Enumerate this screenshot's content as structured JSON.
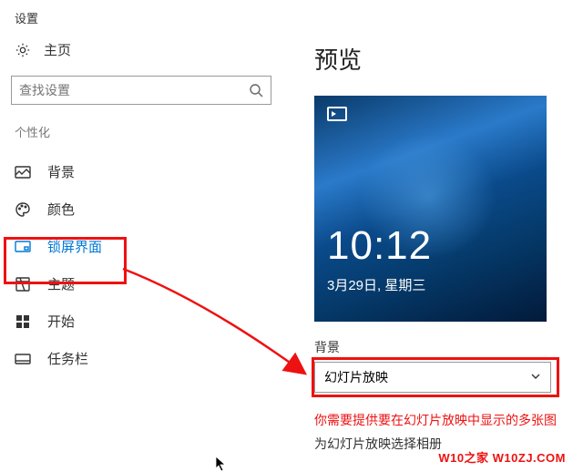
{
  "header": {
    "title": "设置"
  },
  "sidebar": {
    "home_label": "主页",
    "search_placeholder": "查找设置",
    "section_label": "个性化",
    "items": [
      {
        "label": "背景"
      },
      {
        "label": "颜色"
      },
      {
        "label": "锁屏界面"
      },
      {
        "label": "主题"
      },
      {
        "label": "开始"
      },
      {
        "label": "任务栏"
      }
    ]
  },
  "main": {
    "preview_title": "预览",
    "clock": "10:12",
    "date": "3月29日, 星期三",
    "bg_label": "背景",
    "dropdown_value": "幻灯片放映",
    "warn_text": "你需要提供要在幻灯片放映中显示的多张图",
    "sub_text": "为幻灯片放映选择相册"
  },
  "watermark": "W10之家 W10ZJ.COM"
}
